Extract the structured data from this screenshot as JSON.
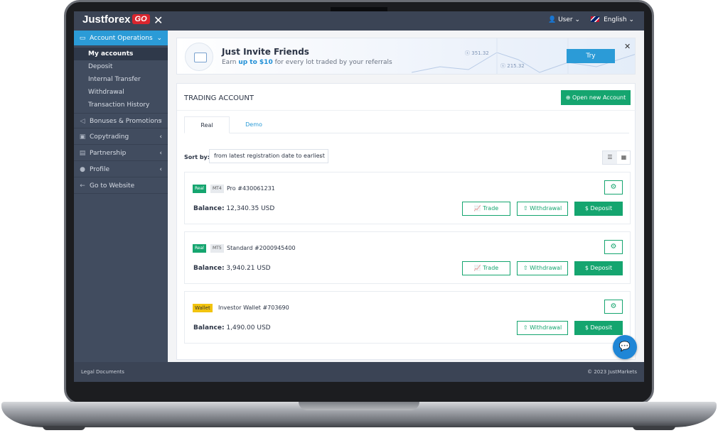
{
  "topbar": {
    "brand": "Justforex",
    "brand_go": "GO",
    "user_label": "User",
    "language_label": "English"
  },
  "sidebar": {
    "sections": [
      {
        "label": "Account Operations",
        "icon": "folder-icon",
        "active": true
      },
      {
        "label": "Bonuses & Promotions",
        "icon": "megaphone-icon"
      },
      {
        "label": "Copytrading",
        "icon": "copy-icon"
      },
      {
        "label": "Partnership",
        "icon": "briefcase-icon"
      },
      {
        "label": "Profile",
        "icon": "user-icon"
      },
      {
        "label": "Go to Website",
        "icon": "arrow-left-icon"
      }
    ],
    "sub_items": [
      "My accounts",
      "Deposit",
      "Internal Transfer",
      "Withdrawal",
      "Transaction History"
    ]
  },
  "banner": {
    "title": "Just Invite Friends",
    "sub_before": "Earn ",
    "sub_bold": "up to $10",
    "sub_after": " for every lot traded by your referrals",
    "try_label": "Try",
    "amount1": "351.32",
    "amount2": "215.32"
  },
  "panel": {
    "title": "TRADING ACCOUNT",
    "open_label": "Open new Account",
    "tabs": [
      "Real",
      "Demo"
    ],
    "sort_label": "Sort by:",
    "sort_value": "from latest registration date to earliest"
  },
  "accounts": [
    {
      "type": "Real",
      "platform": "MT4",
      "name": "Pro #430061231",
      "balance_label": "Balance:",
      "balance": "12,340.35 USD"
    },
    {
      "type": "Real",
      "platform": "MT5",
      "name": "Standard #2000945400",
      "balance_label": "Balance:",
      "balance": "3,940.21 USD"
    },
    {
      "type": "Wallet",
      "platform": "",
      "name": "Investor Wallet #703690",
      "balance_label": "Balance:",
      "balance": "1,490.00 USD"
    }
  ],
  "actions": {
    "trade": "Trade",
    "withdrawal": "Withdrawal",
    "deposit": "Deposit"
  },
  "footer": {
    "left": "Legal Documents",
    "right": "© 2023 JustMarkets"
  },
  "colors": {
    "accent_blue": "#2b9bd7",
    "green": "#15a56f",
    "sidebar_bg": "#414c5f",
    "wallet_yellow": "#f2c40f"
  }
}
